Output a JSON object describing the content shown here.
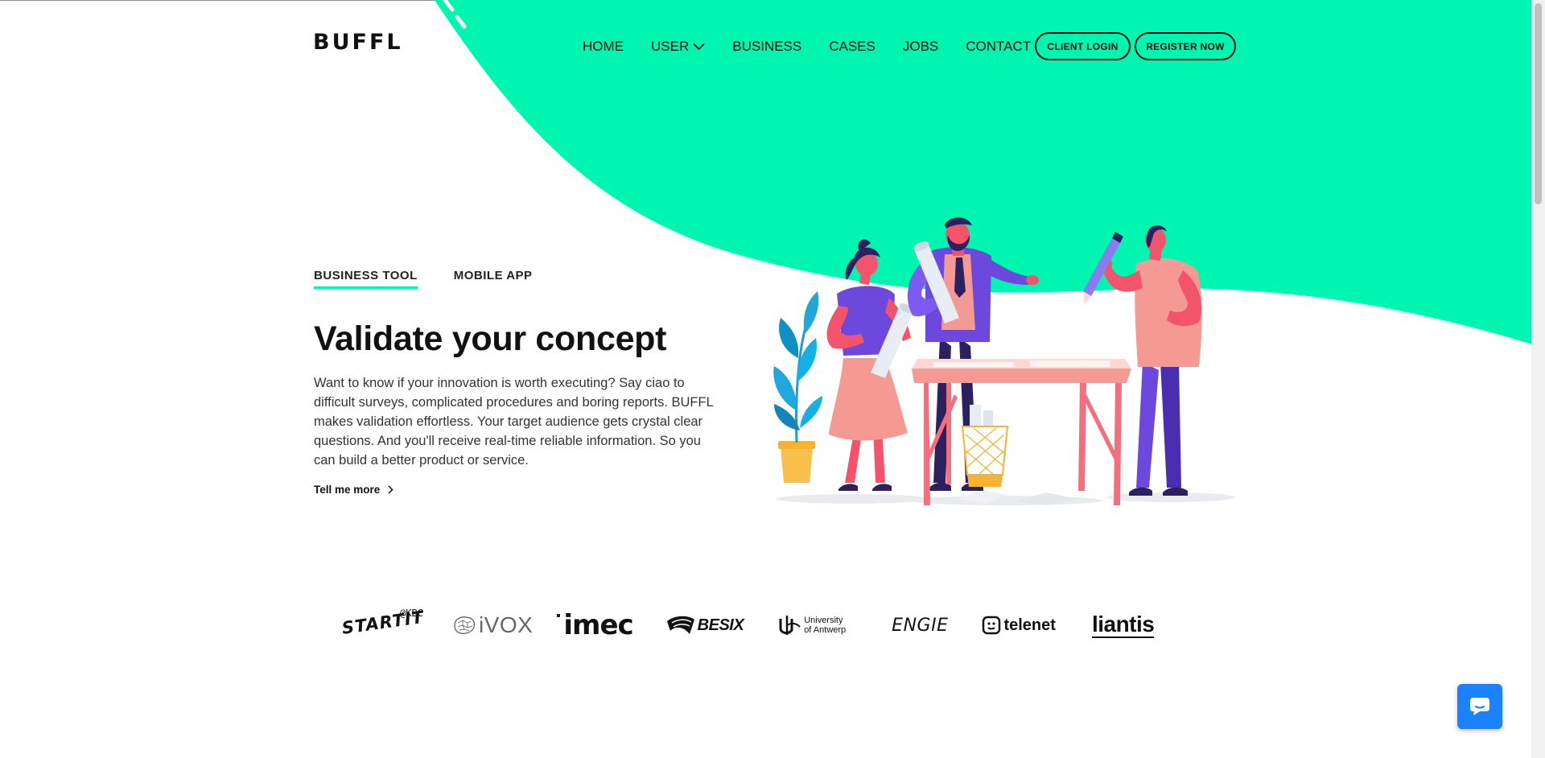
{
  "brand": {
    "logo_text": "BUFFL",
    "accent_color": "#00f5b0"
  },
  "nav": {
    "items": [
      {
        "label": "HOME"
      },
      {
        "label": "USER",
        "has_dropdown": true,
        "icon": "chevron-down-icon"
      },
      {
        "label": "BUSINESS"
      },
      {
        "label": "CASES"
      },
      {
        "label": "JOBS"
      },
      {
        "label": "CONTACT"
      }
    ],
    "client_login": "CLIENT LOGIN",
    "register": "REGISTER NOW"
  },
  "hero": {
    "tabs": [
      {
        "label": "BUSINESS TOOL",
        "active": true
      },
      {
        "label": "MOBILE APP",
        "active": false
      }
    ],
    "heading": "Validate your concept",
    "description": "Want to know if your innovation is worth executing? Say ciao to difficult surveys, complicated procedures and boring reports. BUFFL makes validation effortless. Your target audience gets crystal clear questions. And you'll receive real-time reliable information. So you can build a better product or service.",
    "cta": "Tell me more"
  },
  "partners": {
    "startit_badge": "@KBC",
    "startit": "STARTIT",
    "ivox": "iVOX",
    "imec": "imec",
    "besix": "BESIX",
    "uantwerp_line1": "University",
    "uantwerp_line2": "of Antwerp",
    "engie": "ENGIE",
    "telenet": "telenet",
    "liantis": "liantis"
  },
  "chat": {
    "icon": "chat-bubble-icon",
    "color": "#1a82ff"
  }
}
